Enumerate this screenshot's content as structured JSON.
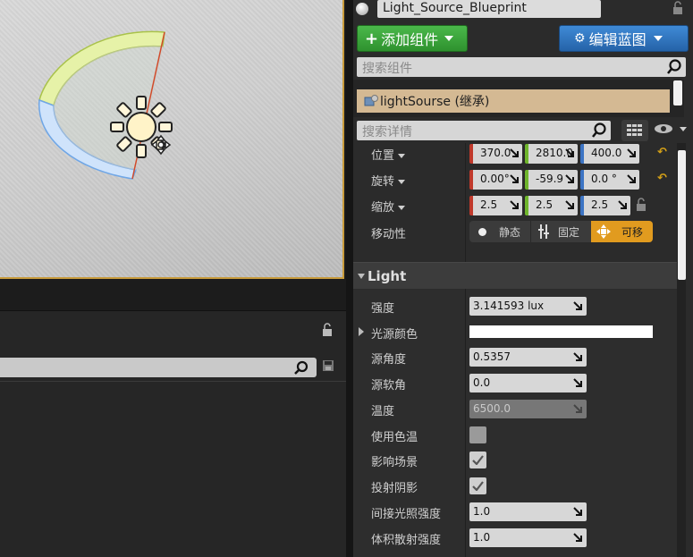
{
  "actor": {
    "name": "Light_Source_Blueprint"
  },
  "toolbar": {
    "add_component_label": "添加组件",
    "edit_blueprint_label": "编辑蓝图"
  },
  "components": {
    "search_placeholder": "搜索组件",
    "items": [
      {
        "label": "lightSourse (继承)"
      }
    ]
  },
  "details": {
    "search_placeholder": "搜索详情",
    "transform": {
      "location": {
        "label": "位置",
        "x": "370.0",
        "y": "2810.0",
        "z": "400.0"
      },
      "rotation": {
        "label": "旋转",
        "x": "0.00°",
        "y": "-59.9",
        "z": "0.0 °"
      },
      "scale": {
        "label": "缩放",
        "x": "2.5",
        "y": "2.5",
        "z": "2.5"
      },
      "mobility": {
        "label": "移动性",
        "options": [
          {
            "label": "静态",
            "icon": "dot-icon"
          },
          {
            "label": "固定",
            "icon": "stationary-icon"
          },
          {
            "label": "可移",
            "icon": "movable-icon"
          }
        ],
        "selected": "可移"
      }
    },
    "light": {
      "section_title": "Light",
      "intensity": {
        "label": "强度",
        "value": "3.141593 lux"
      },
      "light_color": {
        "label": "光源颜色",
        "value": "#ffffff"
      },
      "source_angle": {
        "label": "源角度",
        "value": "0.5357"
      },
      "source_soft_angle": {
        "label": "源软角",
        "value": "0.0"
      },
      "temperature": {
        "label": "温度",
        "value": "6500.0"
      },
      "use_temperature": {
        "label": "使用色温",
        "checked": false
      },
      "affects_world": {
        "label": "影响场景",
        "checked": true
      },
      "cast_shadows": {
        "label": "投射阴影",
        "checked": true
      },
      "indirect_lighting_intensity": {
        "label": "间接光照强度",
        "value": "1.0"
      },
      "volumetric_scattering_intensity": {
        "label": "体积散射强度",
        "value": "1.0"
      }
    }
  },
  "colors": {
    "accent_orange": "#e19b1f",
    "add_green": "#3aa63a",
    "edit_blue": "#2f75c2",
    "selected_component": "#d4b993"
  }
}
